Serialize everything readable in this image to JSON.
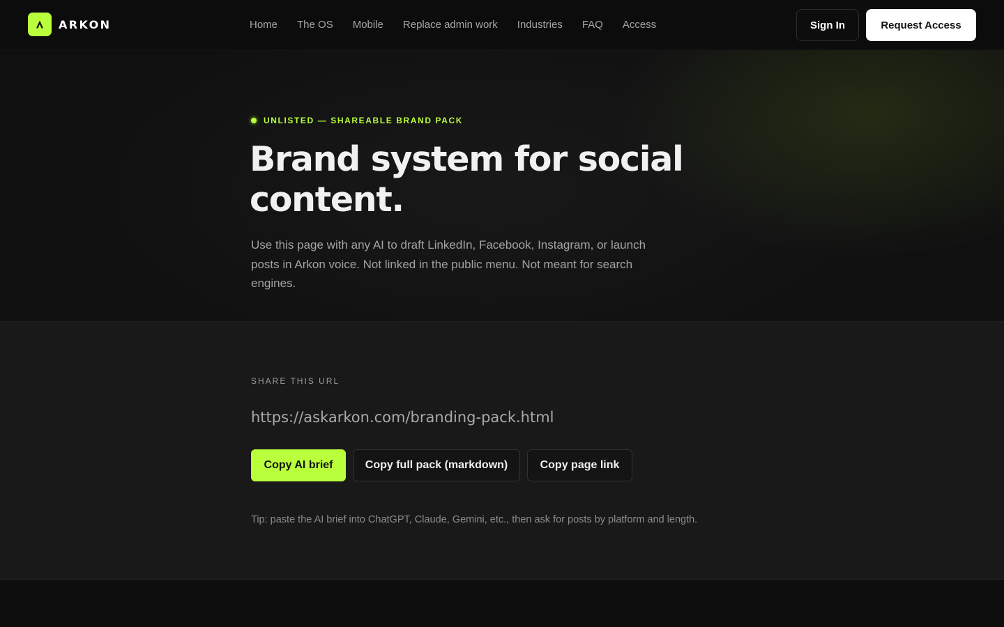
{
  "brand": {
    "name": "ARKON",
    "accent_color": "#b9ff3b",
    "logo_icon": "arkon-logo-icon"
  },
  "nav": {
    "items": [
      {
        "label": "Home"
      },
      {
        "label": "The OS"
      },
      {
        "label": "Mobile"
      },
      {
        "label": "Replace admin work"
      },
      {
        "label": "Industries"
      },
      {
        "label": "FAQ"
      },
      {
        "label": "Access"
      }
    ]
  },
  "header_actions": {
    "sign_in": "Sign In",
    "request_access": "Request Access"
  },
  "hero": {
    "eyebrow": "UNLISTED — SHAREABLE BRAND PACK",
    "title": "Brand system for social content.",
    "description": "Use this page with any AI to draft LinkedIn, Facebook, Instagram, or launch posts in Arkon voice. Not linked in the public menu. Not meant for search engines."
  },
  "share": {
    "label": "SHARE THIS URL",
    "url": "https://askarkon.com/branding-pack.html",
    "buttons": {
      "copy_ai_brief": "Copy AI brief",
      "copy_full_pack": "Copy full pack (markdown)",
      "copy_page_link": "Copy page link"
    },
    "tip": "Tip: paste the AI brief into ChatGPT, Claude, Gemini, etc., then ask for posts by platform and length."
  }
}
